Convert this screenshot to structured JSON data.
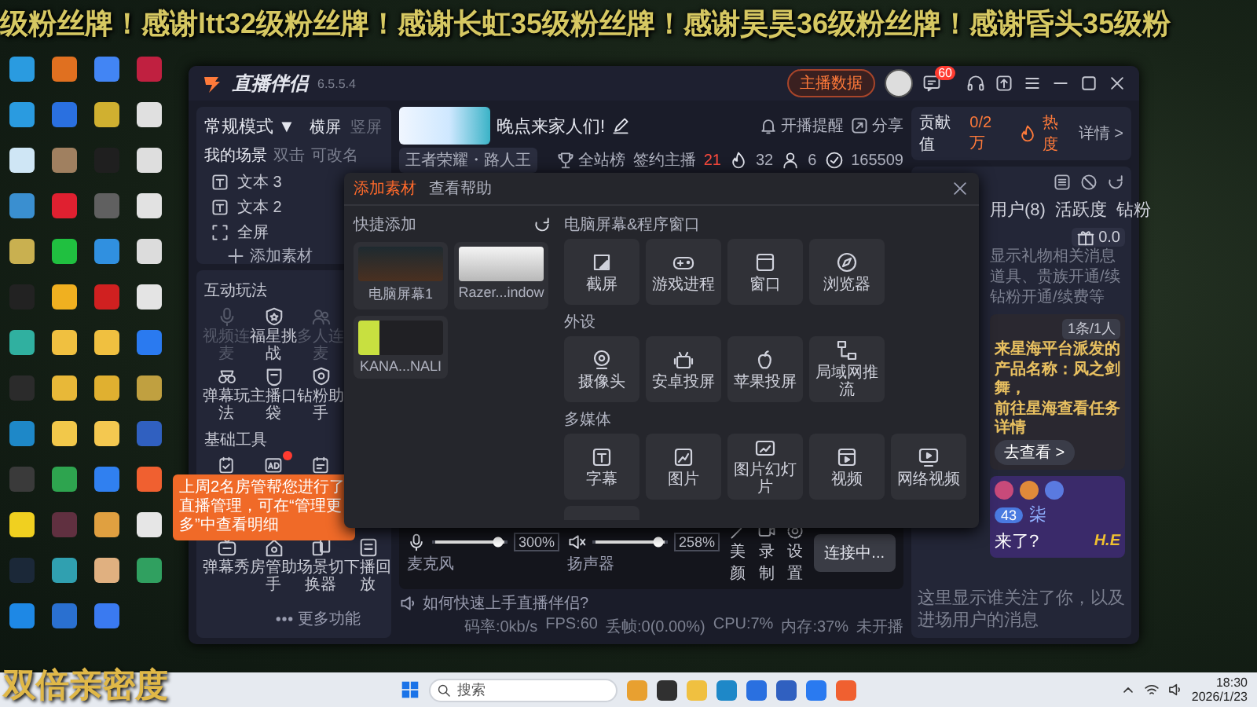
{
  "overlay_banner": "级粉丝牌！感谢ltt32级粉丝牌！感谢长虹35级粉丝牌！感谢昊昊36级粉丝牌！感谢昏头35级粉",
  "overlay_caption": "双倍亲密度",
  "desktop_icons": [
    {
      "color": "#2a9be0"
    },
    {
      "color": "#2a9be0"
    },
    {
      "color": "#cfe6f5"
    },
    {
      "color": "#3a8fd0"
    },
    {
      "color": "#c9b050"
    },
    {
      "color": "#222222"
    },
    {
      "color": "#30b0a0"
    },
    {
      "color": "#2b2b2b"
    },
    {
      "color": "#1e88c8"
    },
    {
      "color": "#3a3a3a"
    },
    {
      "color": "#f0d020"
    },
    {
      "color": "#1b2838"
    },
    {
      "color": "#1e88e5"
    },
    {
      "color": "#e07020"
    },
    {
      "color": "#2a70e0"
    },
    {
      "color": "#a08060"
    },
    {
      "color": "#e02030"
    },
    {
      "color": "#20c040"
    },
    {
      "color": "#f0b020"
    },
    {
      "color": "#f0c040"
    },
    {
      "color": "#e8b838"
    },
    {
      "color": "#f2c84a"
    },
    {
      "color": "#2ea44f"
    },
    {
      "color": "#603040"
    },
    {
      "color": "#30a0b0"
    },
    {
      "color": "#2a70d0"
    },
    {
      "color": "#4285f4"
    },
    {
      "color": "#d0b030"
    },
    {
      "color": "#1f1f1f"
    },
    {
      "color": "#606060"
    },
    {
      "color": "#3090e0"
    },
    {
      "color": "#d02020"
    },
    {
      "color": "#f0c040"
    },
    {
      "color": "#e0b030"
    },
    {
      "color": "#f4c850"
    },
    {
      "color": "#3080f0"
    },
    {
      "color": "#e0a040"
    },
    {
      "color": "#e0b080"
    },
    {
      "color": "#3a7af0"
    },
    {
      "color": "#c02040"
    },
    {
      "color": "#e0e0e0"
    },
    {
      "color": "#dedede"
    },
    {
      "color": "#e2e2e2"
    },
    {
      "color": "#dcdcdc"
    },
    {
      "color": "#e4e4e4"
    },
    {
      "color": "#2a7af0"
    },
    {
      "color": "#c0a040"
    },
    {
      "color": "#3060c0"
    },
    {
      "color": "#f06030"
    },
    {
      "color": "#e6e6e6"
    },
    {
      "color": "#30a060"
    }
  ],
  "app": {
    "title": "直播伴侣",
    "version": "6.5.5.4",
    "data_button": "主播数据",
    "message_badge": "60",
    "mode": "常规模式 ▼",
    "orientations": [
      {
        "label": "横屏",
        "selected": true
      },
      {
        "label": "竖屏",
        "selected": false
      }
    ],
    "scenes": {
      "title": "我的场景",
      "hint_1": "双击",
      "hint_2": "可改名",
      "items": [
        {
          "label": "文本 3",
          "kind": "text"
        },
        {
          "label": "文本 2",
          "kind": "text"
        },
        {
          "label": "全屏",
          "kind": "screen"
        }
      ],
      "add": "添加素材"
    },
    "interactive": {
      "title": "互动玩法",
      "items": [
        {
          "label": "视频连麦",
          "disabled": true
        },
        {
          "label": "福星挑战",
          "disabled": false
        },
        {
          "label": "多人连麦",
          "disabled": true
        },
        {
          "label": "弹幕玩法",
          "disabled": false
        },
        {
          "label": "主播口袋",
          "disabled": false
        },
        {
          "label": "钻粉助手",
          "disabled": false
        }
      ]
    },
    "tools": {
      "title": "基础工具",
      "hidden_row": [
        {
          "badge": false
        },
        {
          "badge": true
        },
        {
          "badge": false
        }
      ],
      "items": [
        "弹幕秀",
        "房管助手",
        "场景切换器",
        "下播回放"
      ],
      "more": "更多功能"
    },
    "tooltip": "上周2名房管帮您进行了直播管理，可在“管理更多”中查看明细",
    "stream": {
      "title": "晚点来家人们!",
      "category": "王者荣耀・路人王",
      "remind": "开播提醒",
      "share": "分享",
      "rank": "全站榜",
      "signed": "签约主播",
      "signed_count": "21",
      "stats": [
        "32",
        "6",
        "165509"
      ]
    },
    "audio": {
      "mic": {
        "label": "麦克风",
        "level": 1.0,
        "reading": "300%"
      },
      "speaker": {
        "label": "扬声器",
        "level": 1.0,
        "reading": "258%"
      },
      "tools": [
        "美颜",
        "录制",
        "设置"
      ],
      "connect": "连接中..."
    },
    "status": {
      "help": "如何快速上手直播伴侣?",
      "metrics": [
        "码率:0kb/s",
        "FPS:60",
        "丢帧:0(0.00%)",
        "CPU:7%",
        "内存:37%",
        "未开播"
      ]
    },
    "right": {
      "contrib_label": "贡献值",
      "contrib_value": "0/2万",
      "heat": "热度",
      "detail": "详情 >",
      "tabs": [
        "用户(8)",
        "活跃度",
        "钻粉"
      ],
      "gift_value": "0.0",
      "gift_lines": [
        "显示礼物相关消息",
        "道具、贵族开通/续",
        "钻粉开通/续费等"
      ],
      "star": {
        "count": "1条/1人",
        "lines": [
          "来星海平台派发的",
          "产品名称：风之剑舞，",
          "前往星海查看任务详情"
        ],
        "action": "去查看 >"
      },
      "chat": {
        "level": "43",
        "name": "柒",
        "message": "来了?",
        "tag": "H.E"
      },
      "follow_hint": "这里显示谁关注了你，以及进场用户的消息"
    }
  },
  "dialog": {
    "tabs": [
      {
        "label": "添加素材",
        "selected": true
      },
      {
        "label": "查看帮助",
        "selected": false
      }
    ],
    "quick_title": "快捷添加",
    "quick_items": [
      "电脑屏幕1",
      "Razer...indow",
      "KANA...NALI"
    ],
    "sections": [
      {
        "title": "电脑屏幕&程序窗口",
        "items": [
          "截屏",
          "游戏进程",
          "窗口",
          "浏览器"
        ]
      },
      {
        "title": "外设",
        "items": [
          "摄像头",
          "安卓投屏",
          "苹果投屏",
          "局域网推流"
        ]
      },
      {
        "title": "多媒体",
        "items": [
          "字幕",
          "图片",
          "图片幻灯片",
          "视频",
          "网络视频"
        ]
      }
    ]
  },
  "taskbar": {
    "search": {
      "placeholder": "搜索"
    },
    "time": "18:30",
    "date": "2026/1/23"
  }
}
